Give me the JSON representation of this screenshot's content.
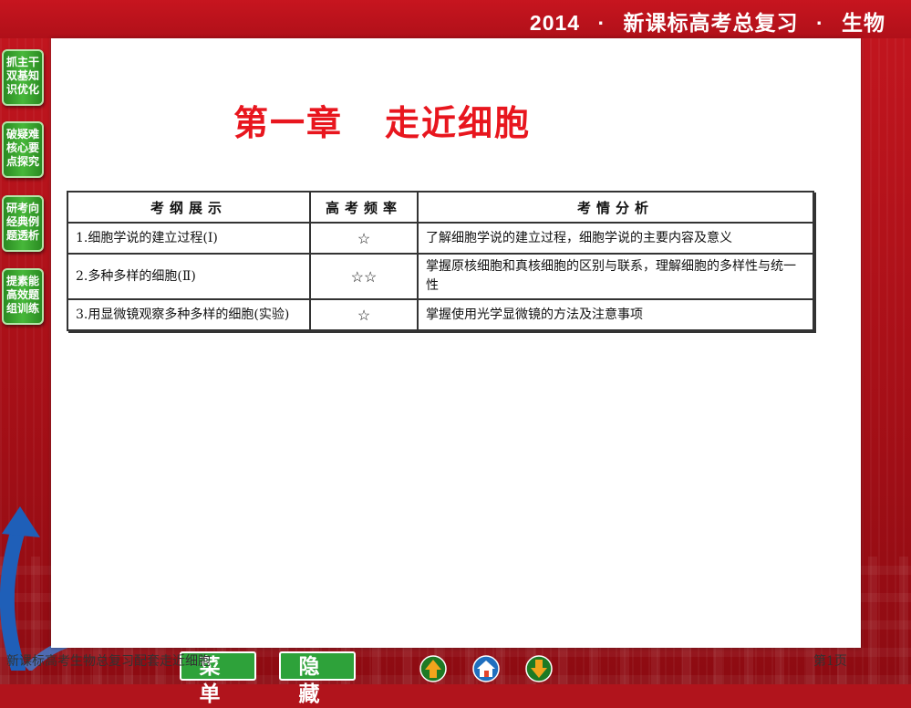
{
  "header": {
    "year": "2014",
    "sep": "·",
    "course": "新课标高考总复习",
    "subject": "生物"
  },
  "side_tabs": [
    {
      "lines": [
        "抓主干",
        "双基知",
        "识优化"
      ]
    },
    {
      "lines": [
        "破疑难",
        "核心要",
        "点探究"
      ]
    },
    {
      "lines": [
        "研考向",
        "经典例",
        "题透析"
      ]
    },
    {
      "lines": [
        "提素能",
        "高效题",
        "组训练"
      ]
    }
  ],
  "slide": {
    "title_part1": "第一章",
    "title_part2": "走近细胞"
  },
  "table": {
    "headers": [
      "考纲展示",
      "高考频率",
      "考情分析"
    ],
    "rows": [
      {
        "item": "1.细胞学说的建立过程(Ⅰ)",
        "freq": "☆",
        "analysis": "了解细胞学说的建立过程，细胞学说的主要内容及意义"
      },
      {
        "item": "2.多种多样的细胞(Ⅱ)",
        "freq": "☆☆",
        "analysis": "掌握原核细胞和真核细胞的区别与联系，理解细胞的多样性与统一性"
      },
      {
        "item": "3.用显微镜观察多种多样的细胞(实验)",
        "freq": "☆",
        "analysis": "掌握使用光学显微镜的方法及注意事项"
      }
    ]
  },
  "footer": {
    "text": "新课标高考生物总复习配套走近细胞",
    "page": "第1页",
    "menu_label": "菜单",
    "hide_label": "隐藏"
  },
  "icons": {
    "nav_up": "up-arrow-icon",
    "nav_home": "home-icon",
    "nav_down": "down-arrow-icon"
  },
  "colors": {
    "frame_red": "#b1141c",
    "title_red": "#e8161e",
    "tab_green": "#3aa82f"
  }
}
